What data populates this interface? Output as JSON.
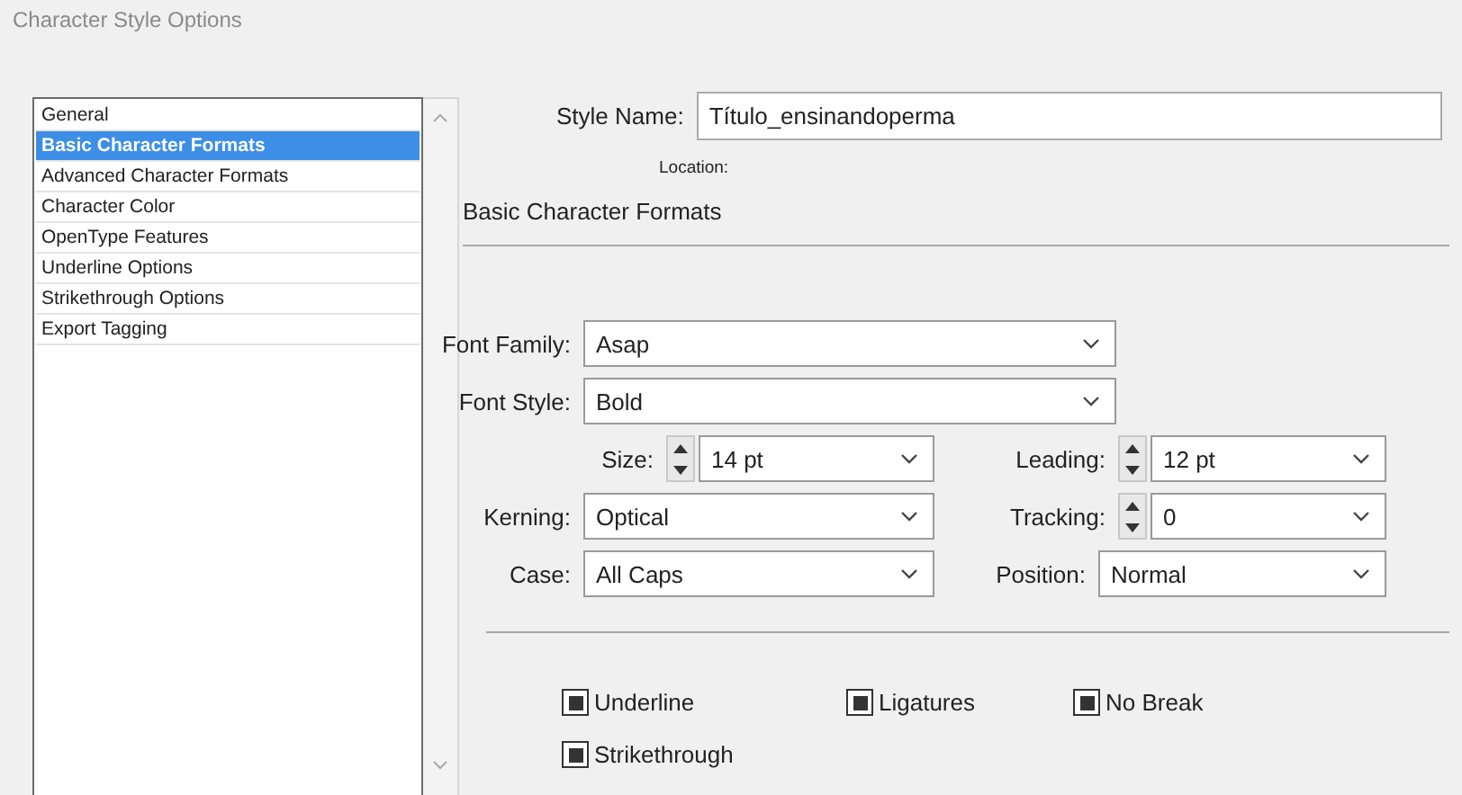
{
  "window": {
    "title": "Character Style Options"
  },
  "sidebar": {
    "items": [
      {
        "label": "General",
        "selected": false
      },
      {
        "label": "Basic Character Formats",
        "selected": true
      },
      {
        "label": "Advanced Character Formats",
        "selected": false
      },
      {
        "label": "Character Color",
        "selected": false
      },
      {
        "label": "OpenType Features",
        "selected": false
      },
      {
        "label": "Underline Options",
        "selected": false
      },
      {
        "label": "Strikethrough Options",
        "selected": false
      },
      {
        "label": "Export Tagging",
        "selected": false
      }
    ]
  },
  "style_name": {
    "label": "Style Name:",
    "value": "Título_ensinandoperma"
  },
  "location": {
    "label": "Location:"
  },
  "section_title": "Basic Character Formats",
  "rows": [
    {
      "fields": [
        {
          "label": "Font Family:",
          "value": "Asap",
          "kind": "wide"
        }
      ]
    },
    {
      "fields": [
        {
          "label": "Font Style:",
          "value": "Bold",
          "kind": "wide"
        }
      ]
    },
    {
      "fields": [
        {
          "label": "Size:",
          "value": "14 pt",
          "kind": "spin"
        },
        {
          "label": "Leading:",
          "value": "12 pt",
          "kind": "spin"
        }
      ]
    },
    {
      "fields": [
        {
          "label": "Kerning:",
          "value": "Optical",
          "kind": "dropdown"
        },
        {
          "label": "Tracking:",
          "value": "0",
          "kind": "spin"
        }
      ]
    },
    {
      "fields": [
        {
          "label": "Case:",
          "value": "All Caps",
          "kind": "dropdown"
        },
        {
          "label": "Position:",
          "value": "Normal",
          "kind": "dropdown"
        }
      ]
    }
  ],
  "checks": [
    {
      "label": "Underline",
      "indeterminate": true
    },
    {
      "label": "Ligatures",
      "indeterminate": true
    },
    {
      "label": "No Break",
      "indeterminate": true
    },
    {
      "label": "Strikethrough",
      "indeterminate": true
    }
  ]
}
